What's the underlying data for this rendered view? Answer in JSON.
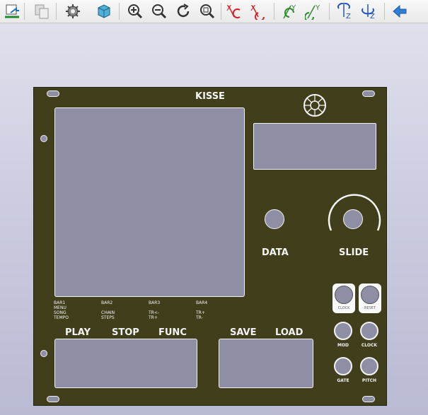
{
  "toolbar": {
    "buttons": [
      {
        "name": "open-document-button",
        "icon": "open-document-icon"
      },
      {
        "name": "copy-view-button",
        "icon": "copy-icon"
      },
      {
        "name": "settings-button",
        "icon": "gear-icon"
      },
      {
        "name": "view-3d-button",
        "icon": "cube-icon"
      },
      {
        "name": "zoom-in-button",
        "icon": "zoom-in-icon"
      },
      {
        "name": "zoom-out-button",
        "icon": "zoom-out-icon"
      },
      {
        "name": "redraw-button",
        "icon": "redraw-icon"
      },
      {
        "name": "zoom-fit-button",
        "icon": "zoom-fit-icon"
      },
      {
        "name": "rotate-x-cw-button",
        "icon": "rotate-x-icon"
      },
      {
        "name": "rotate-x-ccw-button",
        "icon": "rotate-x-icon"
      },
      {
        "name": "rotate-y-cw-button",
        "icon": "rotate-y-icon"
      },
      {
        "name": "rotate-y-ccw-button",
        "icon": "rotate-y-icon"
      },
      {
        "name": "rotate-z-cw-button",
        "icon": "rotate-z-icon"
      },
      {
        "name": "rotate-z-ccw-button",
        "icon": "rotate-z-icon"
      },
      {
        "name": "back-button",
        "icon": "arrow-left-icon"
      }
    ],
    "axis_x": "X",
    "axis_y": "Y",
    "axis_z": "Z"
  },
  "panel": {
    "title": "KISSE",
    "data_label": "DATA",
    "slide_label": "SLIDE",
    "play_label": "PLAY",
    "stop_label": "STOP",
    "func_label": "FUNC",
    "save_label": "SAVE",
    "load_label": "LOAD",
    "clock_button_label": "CLOCK",
    "reset_button_label": "RESET",
    "jacks": {
      "mod": "MOD",
      "clock": "CLOCK",
      "gate": "GATE",
      "pitch": "PITCH"
    },
    "func_groups": [
      {
        "lines": [
          "BAR1",
          "MENU",
          "SONG",
          "TEMPO"
        ]
      },
      {
        "lines": [
          "BAR2",
          "",
          "CHAIN",
          "STEPS"
        ]
      },
      {
        "lines": [
          "BAR3",
          "",
          "TR<-",
          "TR+"
        ]
      },
      {
        "lines": [
          "BAR4",
          "",
          "TR+",
          "TR-"
        ]
      }
    ]
  },
  "colors": {
    "panel": "#413e1c",
    "cutout": "#8e8ea4",
    "outline": "#f2f2f2",
    "x_axis": "#d42020",
    "y_axis": "#2d8a2d",
    "z_axis": "#2255bb",
    "nav_arrow": "#2f7fd6"
  }
}
